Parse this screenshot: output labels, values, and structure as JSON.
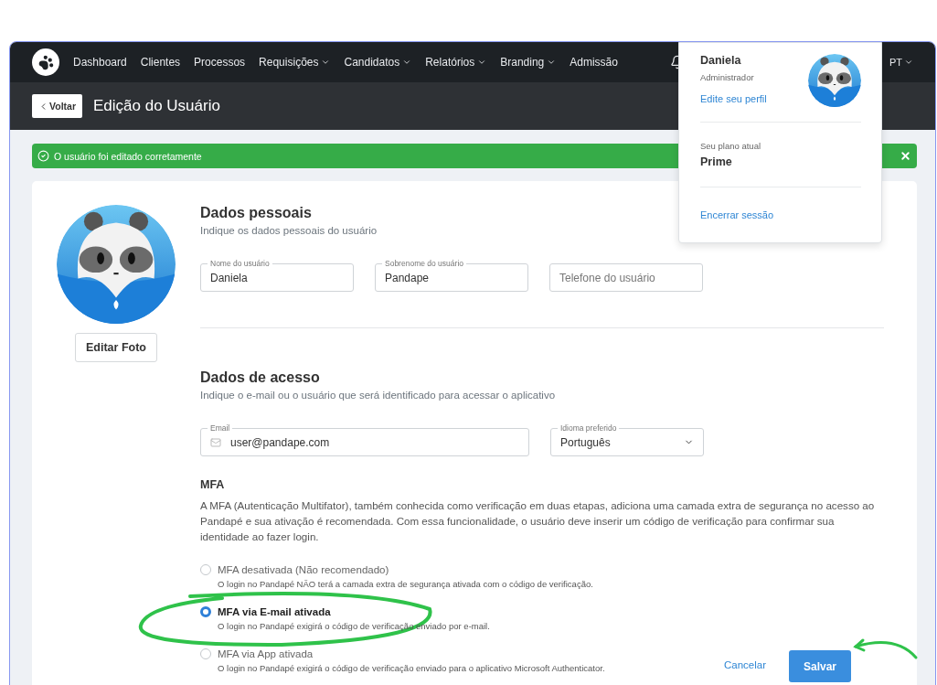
{
  "navbar": {
    "items": [
      {
        "label": "Dashboard",
        "dropdown": false
      },
      {
        "label": "Clientes",
        "dropdown": false
      },
      {
        "label": "Processos",
        "dropdown": false
      },
      {
        "label": "Requisições",
        "dropdown": true
      },
      {
        "label": "Candidatos",
        "dropdown": true
      },
      {
        "label": "Relatórios",
        "dropdown": true
      },
      {
        "label": "Branding",
        "dropdown": true
      },
      {
        "label": "Admissão",
        "dropdown": false
      }
    ],
    "language": "PT"
  },
  "page_header": {
    "back_button": "Voltar",
    "title": "Edição do Usuário"
  },
  "alert": {
    "message": "O usuário foi editado corretamente"
  },
  "profile": {
    "edit_photo_button": "Editar Foto"
  },
  "personal_section": {
    "title": "Dados pessoais",
    "subtitle": "Indique os dados pessoais do usuário",
    "fields": [
      {
        "label": "Nome do usuário",
        "value": "Daniela"
      },
      {
        "label": "Sobrenome do usuário",
        "value": "Pandape"
      },
      {
        "placeholder": "Telefone do usuário"
      }
    ]
  },
  "access_section": {
    "title": "Dados de acesso",
    "subtitle": "Indique o e-mail ou o usuário que será identificado para acessar o aplicativo",
    "email": {
      "label": "Email",
      "value": "user@pandape.com"
    },
    "language_select": {
      "label": "Idioma preferido",
      "value": "Português"
    }
  },
  "mfa": {
    "title": "MFA",
    "description": "A MFA (Autenticação Multifator), também conhecida como verificação em duas etapas, adiciona uma camada extra de segurança no acesso ao Pandapé e sua ativação é recomendada. Com essa funcionalidade, o usuário deve inserir um código de verificação para confirmar sua identidade ao fazer login.",
    "options": [
      {
        "label": "MFA desativada (Não recomendado)",
        "hint": "O login no Pandapé NÃO terá a camada extra de segurança ativada com o código de verificação.",
        "selected": false
      },
      {
        "label": "MFA via E-mail ativada",
        "hint": "O login no Pandapé exigirá o código de verificação enviado por e-mail.",
        "selected": true
      },
      {
        "label": "MFA via App ativada",
        "hint": "O login no Pandapé exigirá o código de verificação enviado para o aplicativo Microsoft Authenticator.",
        "selected": false
      }
    ]
  },
  "actions": {
    "cancel": "Cancelar",
    "save": "Salvar"
  },
  "user_menu": {
    "name": "Daniela",
    "role": "Administrador",
    "edit_profile_link": "Edite seu perfil",
    "plan_label": "Seu plano atual",
    "plan": "Prime",
    "logout_link": "Encerrar sessão"
  }
}
